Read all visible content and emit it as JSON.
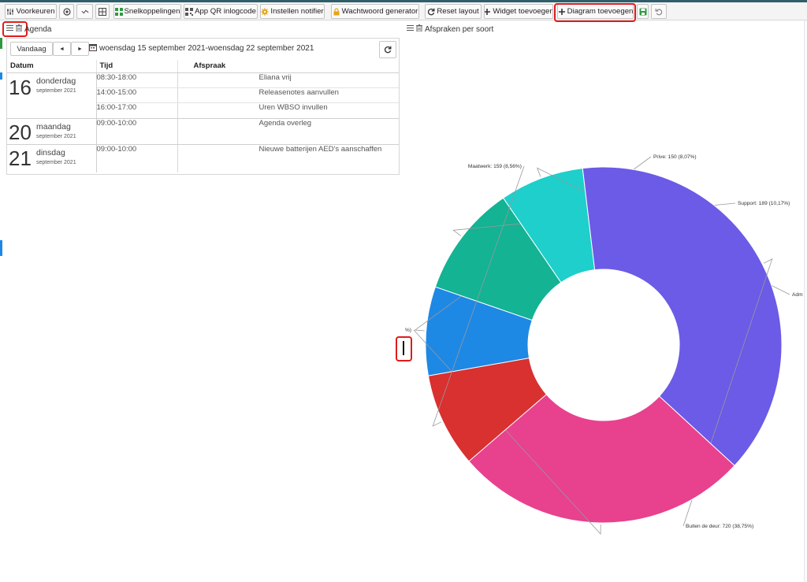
{
  "toolbar": {
    "preferences_label": "Voorkeuren",
    "shortcuts_label": "Snelkoppelingen",
    "qr_label": "App QR inlogcode",
    "notifier_label": "Instellen notifier",
    "password_label": "Wachtwoord generator",
    "reset_label": "Reset layout",
    "add_widget_label": "Widget toevoegen",
    "add_chart_label": "Diagram toevoegen",
    "icons": [
      "sliders-icon",
      "target-icon",
      "wave-icon",
      "grid-icon",
      "apps-icon",
      "qr-icon",
      "gear-icon",
      "lock-icon",
      "refresh-icon",
      "plus-icon",
      "plus-icon",
      "save-icon",
      "undo-icon"
    ]
  },
  "agenda": {
    "panel_title": "Agenda",
    "today_label": "Vandaag",
    "prev_symbol": "◄",
    "next_symbol": "►",
    "date_range": "woensdag 15 september 2021-woensdag 22 september 2021",
    "columns": [
      "Datum",
      "Tijd",
      "Afspraak"
    ],
    "days": [
      {
        "day": "16",
        "weekday": "donderdag",
        "month": "september 2021",
        "items": [
          {
            "time": "08:30-18:00",
            "title": "Eliana vrij"
          },
          {
            "time": "14:00-15:00",
            "title": "Releasenotes aanvullen"
          },
          {
            "time": "16:00-17:00",
            "title": "Uren WBSO invullen"
          }
        ]
      },
      {
        "day": "20",
        "weekday": "maandag",
        "month": "september 2021",
        "items": [
          {
            "time": "09:00-10:00",
            "title": "Agenda overleg"
          }
        ]
      },
      {
        "day": "21",
        "weekday": "dinsdag",
        "month": "september 2021",
        "items": [
          {
            "time": "09:00-10:00",
            "title": "Nieuwe batterijen AED's aanschaffen"
          }
        ]
      }
    ]
  },
  "chart_panel": {
    "title": "Afspraken per soort"
  },
  "chart_data": {
    "type": "pie",
    "title": "Afspraken per soort",
    "donut": true,
    "slices": [
      {
        "label": "Prive: 150",
        "value": 150,
        "percent_text": "(8,07%)",
        "color": "#1e88e5"
      },
      {
        "label": "Support: 189",
        "value": 189,
        "percent_text": "(10,17%)",
        "color": "#13b394"
      },
      {
        "label": "Adm",
        "value": 142,
        "percent_text": "",
        "color": "#1ecfcb"
      },
      {
        "label": "Buiten de deur: 720",
        "value": 720,
        "percent_text": "(38,75%)",
        "color": "#6b5be6"
      },
      {
        "label": "",
        "value": 498,
        "percent_text": "%)",
        "color": "#e8418e"
      },
      {
        "label": "Maatwerk: 159",
        "value": 159,
        "percent_text": "(8,56%)",
        "color": "#d93030"
      }
    ]
  }
}
